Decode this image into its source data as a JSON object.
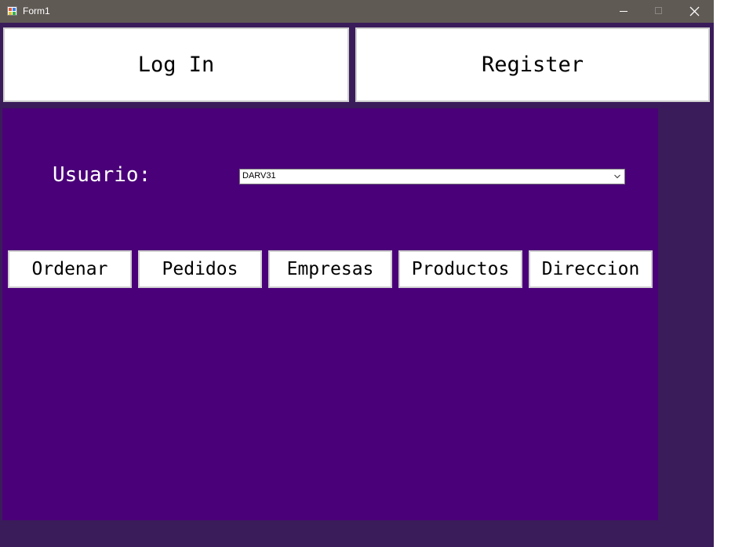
{
  "window": {
    "title": "Form1",
    "colors": {
      "titlebar": "#605a54",
      "window_bg": "#3a1c5a",
      "panel_bg": "#4a0078"
    }
  },
  "titlebar_icons": {
    "app": "app-form-icon",
    "minimize": "minimize-icon",
    "maximize": "maximize-icon",
    "close": "close-icon"
  },
  "top_buttons": {
    "login": "Log In",
    "register": "Register"
  },
  "panel": {
    "user_label": "Usuario:",
    "user_select_value": "DARV31",
    "nav_buttons": [
      "Ordenar",
      "Pedidos",
      "Empresas",
      "Productos",
      "Direccion"
    ]
  }
}
